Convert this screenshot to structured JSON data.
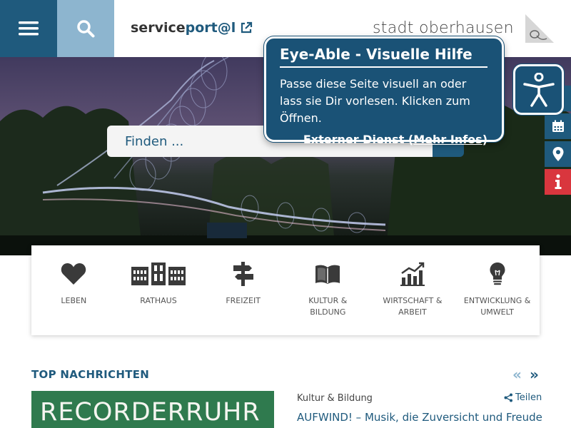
{
  "header": {
    "serviceportal_prefix": "service",
    "serviceportal_accent": "port@l",
    "logo_text": "stadt oberhausen"
  },
  "search": {
    "placeholder": "Finden ..."
  },
  "tooltip": {
    "title": "Eye-Able - Visuelle Hilfe",
    "text": "Passe diese Seite visuell an oder lass sie Dir vorlesen. Klicken zum Öffnen.",
    "external_prefix": "Externer Dienst (",
    "external_link": "Mehr Infos",
    "external_suffix": ")"
  },
  "categories": [
    {
      "label": "LEBEN",
      "icon": "heart-icon"
    },
    {
      "label": "RATHAUS",
      "icon": "building-icon"
    },
    {
      "label": "FREIZEIT",
      "icon": "signpost-icon"
    },
    {
      "label": "KULTUR & BILDUNG",
      "icon": "book-icon"
    },
    {
      "label": "WIRTSCHAFT & ARBEIT",
      "icon": "chart-icon"
    },
    {
      "label": "ENTWICKLUNG & UMWELT",
      "icon": "lightbulb-icon"
    }
  ],
  "news": {
    "title": "TOP NACHRICHTEN",
    "prev": "«",
    "next": "»",
    "image_text": "RECORDERRUHR",
    "category": "Kultur & Bildung",
    "share_label": "Teilen",
    "headline": "AUFWIND! – Musik, die Zuversicht und Freude"
  },
  "colors": {
    "primary": "#1f5a7d",
    "light_blue": "#8db5cf",
    "info_red": "#d9363e",
    "tooltip_bg": "#1a5276"
  }
}
